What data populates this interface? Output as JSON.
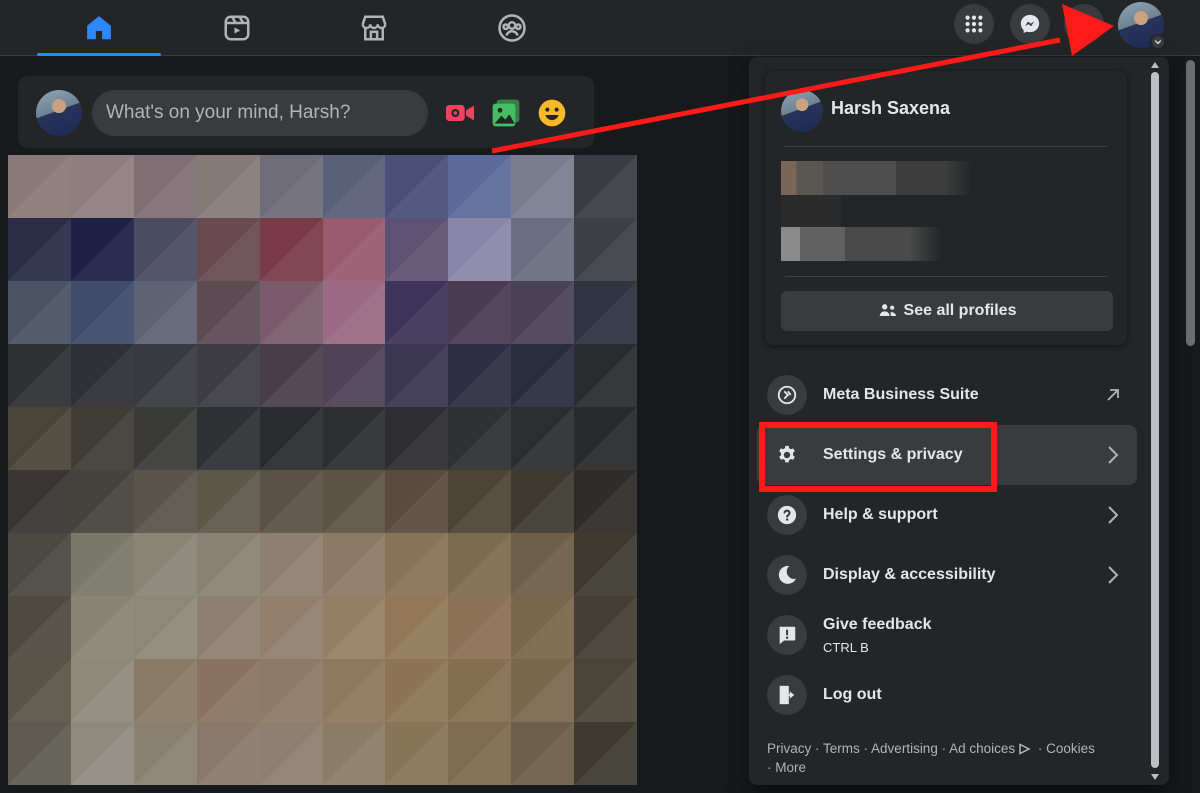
{
  "colors": {
    "accent": "#2d88ff",
    "annotation_red": "#ff1a1a",
    "video_red": "#f3425f",
    "photo_green": "#45bd62",
    "emoji_yellow": "#f7b928"
  },
  "nav": {
    "tabs": [
      {
        "icon": "home-icon",
        "active": true
      },
      {
        "icon": "reels-icon",
        "active": false
      },
      {
        "icon": "marketplace-icon",
        "active": false
      },
      {
        "icon": "groups-icon",
        "active": false
      }
    ],
    "right_icons": [
      "grid-menu-icon",
      "messenger-icon",
      "notifications-icon",
      "profile-avatar"
    ]
  },
  "composer": {
    "placeholder": "What's on your mind, Harsh?",
    "icons": [
      "live-video-icon",
      "photo-icon",
      "feeling-icon"
    ]
  },
  "menu": {
    "profile_name": "Harsh Saxena",
    "see_all_profiles": "See all profiles",
    "items": [
      {
        "label": "Meta Business Suite",
        "icon": "meta-business-icon",
        "trailing": "external-link-icon"
      },
      {
        "label": "Settings & privacy",
        "icon": "gear-icon",
        "trailing": "chevron-right-icon"
      },
      {
        "label": "Help & support",
        "icon": "question-icon",
        "trailing": "chevron-right-icon"
      },
      {
        "label": "Display & accessibility",
        "icon": "moon-icon",
        "trailing": "chevron-right-icon"
      },
      {
        "label": "Give feedback",
        "sublabel": "CTRL B",
        "icon": "feedback-icon"
      },
      {
        "label": "Log out",
        "icon": "logout-icon"
      }
    ],
    "footer": {
      "links": [
        "Privacy",
        "Terms",
        "Advertising",
        "Ad choices",
        "Cookies",
        "More"
      ],
      "separator": " · "
    }
  }
}
